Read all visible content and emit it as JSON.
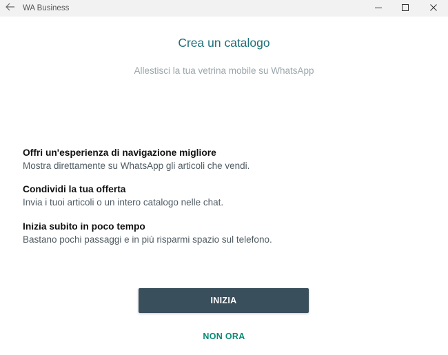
{
  "window": {
    "title": "WA Business",
    "icons": {
      "back": "back-arrow-icon",
      "minimize": "minimize-icon",
      "maximize": "maximize-icon",
      "close": "close-icon"
    }
  },
  "main": {
    "title": "Crea un catalogo",
    "subtitle": "Allestisci la tua vetrina mobile su WhatsApp",
    "features": [
      {
        "heading": "Offri un'esperienza di navigazione migliore",
        "description": "Mostra direttamente su WhatsApp gli articoli che vendi."
      },
      {
        "heading": "Condividi la tua offerta",
        "description": "Invia i tuoi articoli o un intero catalogo nelle chat."
      },
      {
        "heading": "Inizia subito in poco tempo",
        "description": "Bastano pochi passaggi e in più risparmi spazio sul telefono."
      }
    ]
  },
  "actions": {
    "start_label": "INIZIA",
    "later_label": "NON ORA"
  },
  "colors": {
    "title": "#1f6f7a",
    "button_bg": "#3a4f5c",
    "link": "#0a8a76"
  }
}
